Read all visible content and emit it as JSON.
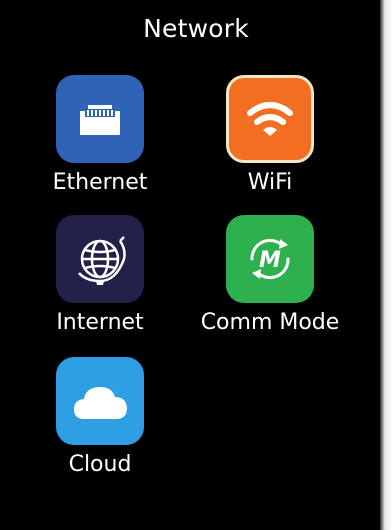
{
  "header": {
    "title": "Network"
  },
  "tiles": [
    {
      "label": "Ethernet",
      "icon": "ethernet-port-icon",
      "color": "#2f63b8"
    },
    {
      "label": "WiFi",
      "icon": "wifi-icon",
      "color": "#f26f22"
    },
    {
      "label": "Internet",
      "icon": "globe-icon",
      "color": "#22214a"
    },
    {
      "label": "Comm Mode",
      "icon": "comm-mode-icon",
      "color": "#2fb04f"
    },
    {
      "label": "Cloud",
      "icon": "cloud-icon",
      "color": "#2f9fe4"
    }
  ],
  "colors": {
    "background": "#000000",
    "text": "#ffffff"
  }
}
